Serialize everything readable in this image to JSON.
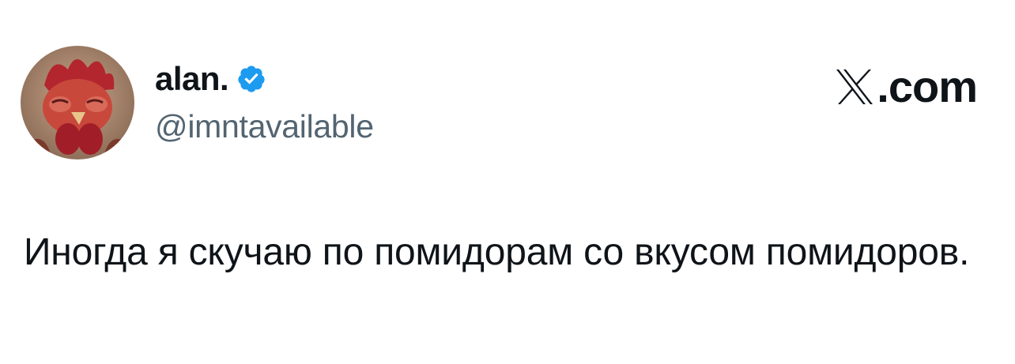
{
  "author": {
    "display_name": "alan.",
    "handle": "@imntavailable",
    "verified": true,
    "avatar": "rooster-avatar"
  },
  "brand": {
    "domain_suffix": ".com",
    "logo": "x-logo-icon"
  },
  "tweet": {
    "text": "Иногда я скучаю по помидорам со вкусом помидоров."
  },
  "colors": {
    "verified_blue": "#1d9bf0",
    "text_primary": "#0f1419",
    "text_secondary": "#536471"
  }
}
